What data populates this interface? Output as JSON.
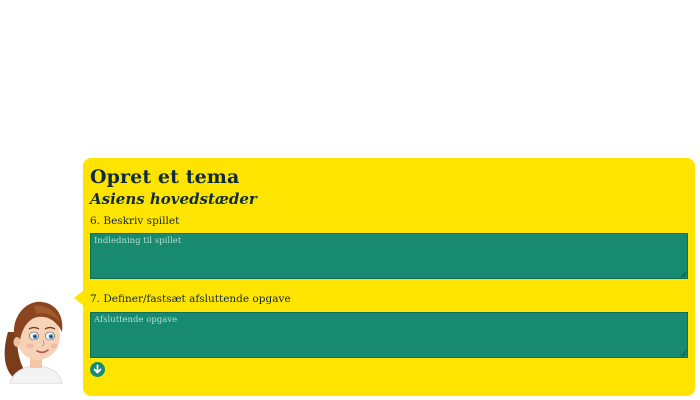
{
  "panel": {
    "title": "Opret et tema",
    "subtitle": "Asiens hovedstæder",
    "background_color": "#ffe400",
    "accent_color": "#178a70"
  },
  "steps": [
    {
      "label": "6. Beskriv spillet",
      "field_value": "",
      "field_placeholder": "Indledning til spillet"
    },
    {
      "label": "7. Definer/fastsæt afsluttende opgave",
      "field_value": "",
      "field_placeholder": "Afsluttende opgave"
    }
  ],
  "icons": {
    "avatar": "guide-avatar-icon",
    "next": "arrow-down-circle-icon",
    "resize": "resize-grip-icon"
  }
}
